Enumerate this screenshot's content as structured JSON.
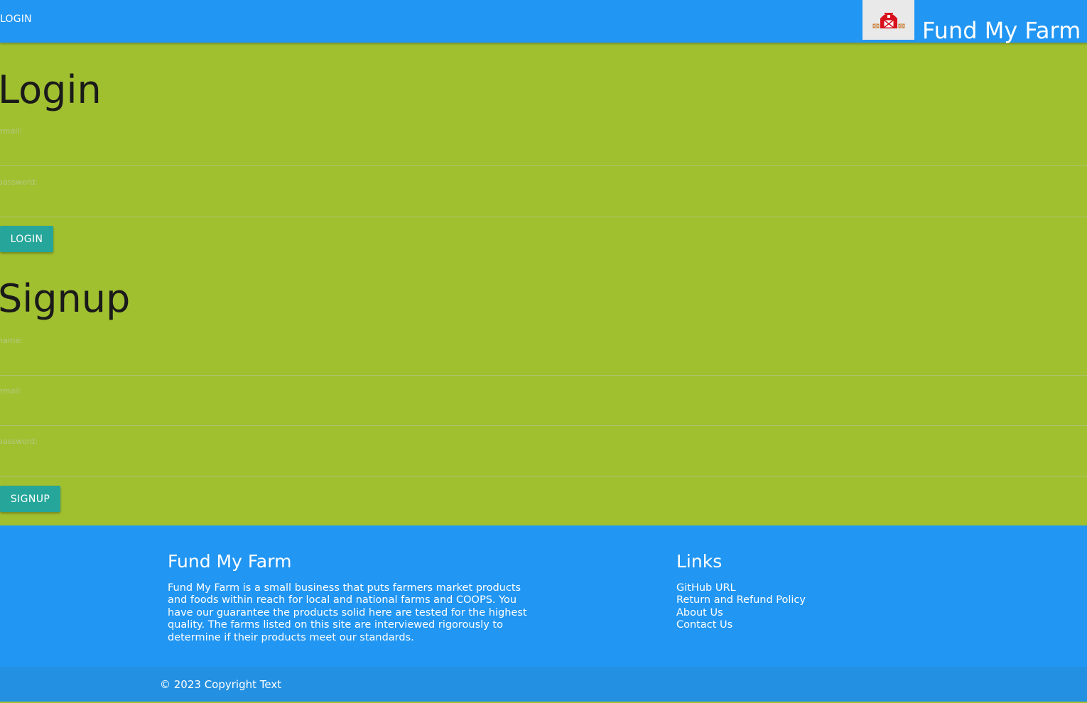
{
  "nav": {
    "login_link": "LOGIN",
    "brand": "Fund My Farm",
    "logo_icon": "barn-icon",
    "color": "#2196f3"
  },
  "login": {
    "heading": "Login",
    "email_label": "email:",
    "password_label": "password:",
    "button": "LOGIN"
  },
  "signup": {
    "heading": "Signup",
    "name_label": "name:",
    "email_label": "email:",
    "password_label": "password:",
    "button": "SIGNUP"
  },
  "footer": {
    "title": "Fund My Farm",
    "description": "Fund My Farm is a small business that puts farmers market products and foods within reach for local and national farms and COOPS. You have our guarantee the products solid here are tested for the highest quality. The farms listed on this site are interviewed rigorously to determine if their products meet our standards.",
    "links_title": "Links",
    "links": [
      "GitHub URL",
      "Return and Refund Policy",
      "About Us",
      "Contact Us"
    ],
    "copyright": "© 2023 Copyright Text"
  },
  "colors": {
    "main_background": "#a0c030",
    "button": "#26a69a",
    "copyright_bar": "#2490e2"
  }
}
